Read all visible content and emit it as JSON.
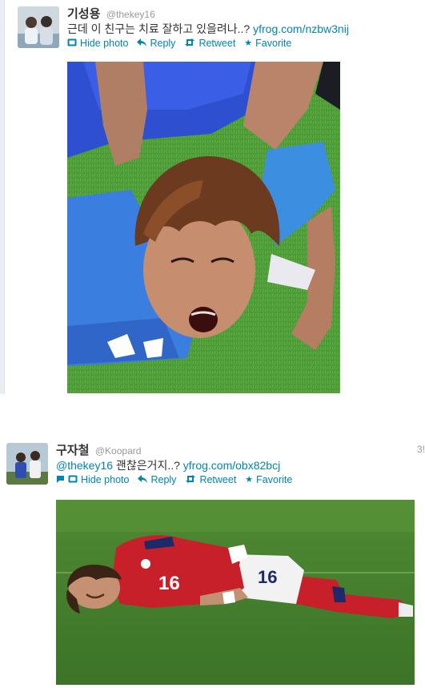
{
  "tweets": [
    {
      "fullname": "기성용",
      "screenname": "@thekey16",
      "text": "근데 이 친구는 치료 잘하고 있을려나..? ",
      "link": "yfrog.com/nzbw3nij",
      "actions": {
        "photo": "Hide photo",
        "reply": "Reply",
        "retweet": "Retweet",
        "favorite": "Favorite"
      },
      "icons": [
        "photo-icon",
        "reply-icon",
        "retweet-icon",
        "favorite-icon"
      ]
    },
    {
      "fullname": "구자철",
      "screenname": "@Koopard",
      "timestamp": "3!",
      "text_prefix": "@thekey16",
      "text": " 괜찮은거지..? ",
      "link": "yfrog.com/obx82bcj",
      "actions": {
        "photo": "Hide photo",
        "reply": "Reply",
        "retweet": "Retweet",
        "favorite": "Favorite"
      },
      "icons": [
        "conversation-icon",
        "photo-icon",
        "reply-icon",
        "retweet-icon",
        "favorite-icon"
      ]
    }
  ],
  "colors": {
    "link": "#0084b4",
    "text": "#333333",
    "muted": "#999999",
    "grass": "#3f8a2e",
    "kit_blue": "#2f6ad8",
    "kit_red": "#c8202a"
  }
}
